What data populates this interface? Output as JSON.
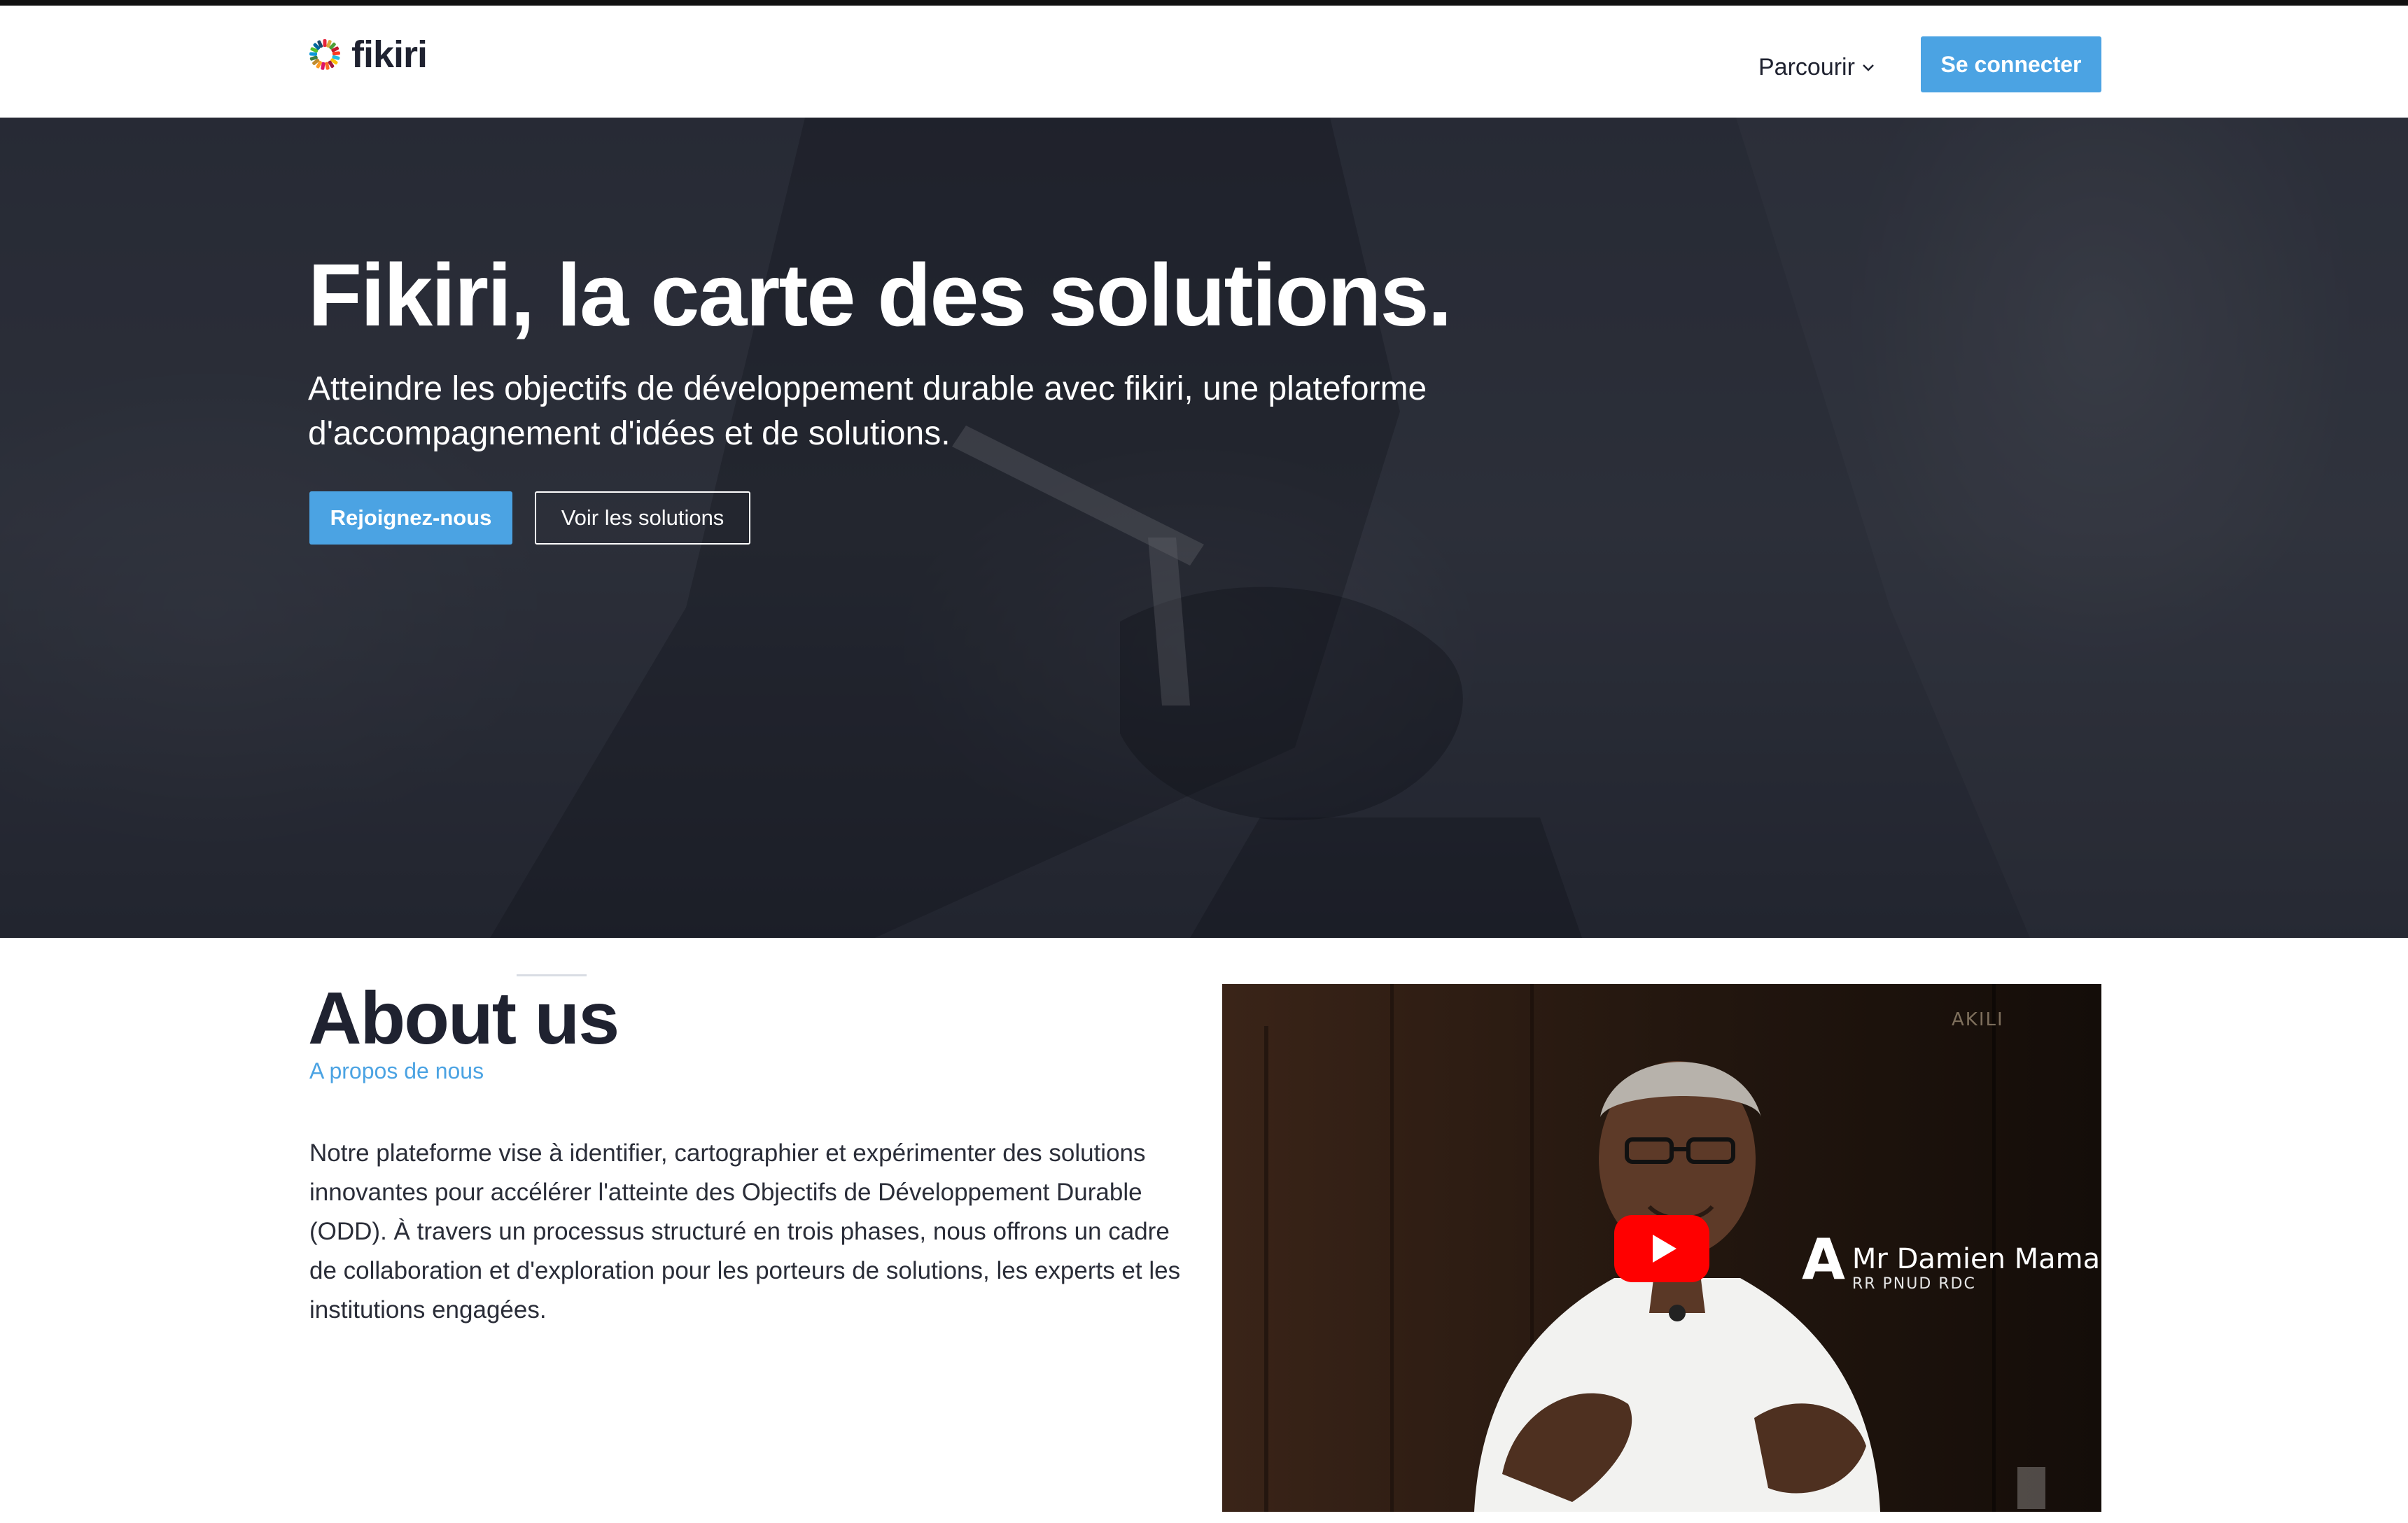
{
  "brand": {
    "logo_text": "fikiri",
    "accent": "#4ba3e3"
  },
  "nav": {
    "browse_label": "Parcourir",
    "login_label": "Se connecter"
  },
  "hero": {
    "title": "Fikiri, la carte des solutions.",
    "subtitle": "Atteindre les objectifs de développement durable avec fikiri, une plateforme d'accompagnement d'idées et de solutions.",
    "join_label": "Rejoignez-nous",
    "solutions_label": "Voir les solutions"
  },
  "about": {
    "title": "About us",
    "subtitle": "A propos de nous",
    "text": "Notre plateforme vise à identifier, cartographier et expérimenter des solutions innovantes pour accélérer l'atteinte des Objectifs de Développement Durable (ODD). À travers un processus structuré en trois phases, nous offrons un cadre de collaboration et d'exploration pour les porteurs de solutions, les experts et les institutions engagées."
  },
  "video": {
    "channel_mark": "AKILI",
    "badge": "A",
    "speaker_name": "Mr Damien Mama",
    "speaker_role": "RR PNUD RDC"
  }
}
